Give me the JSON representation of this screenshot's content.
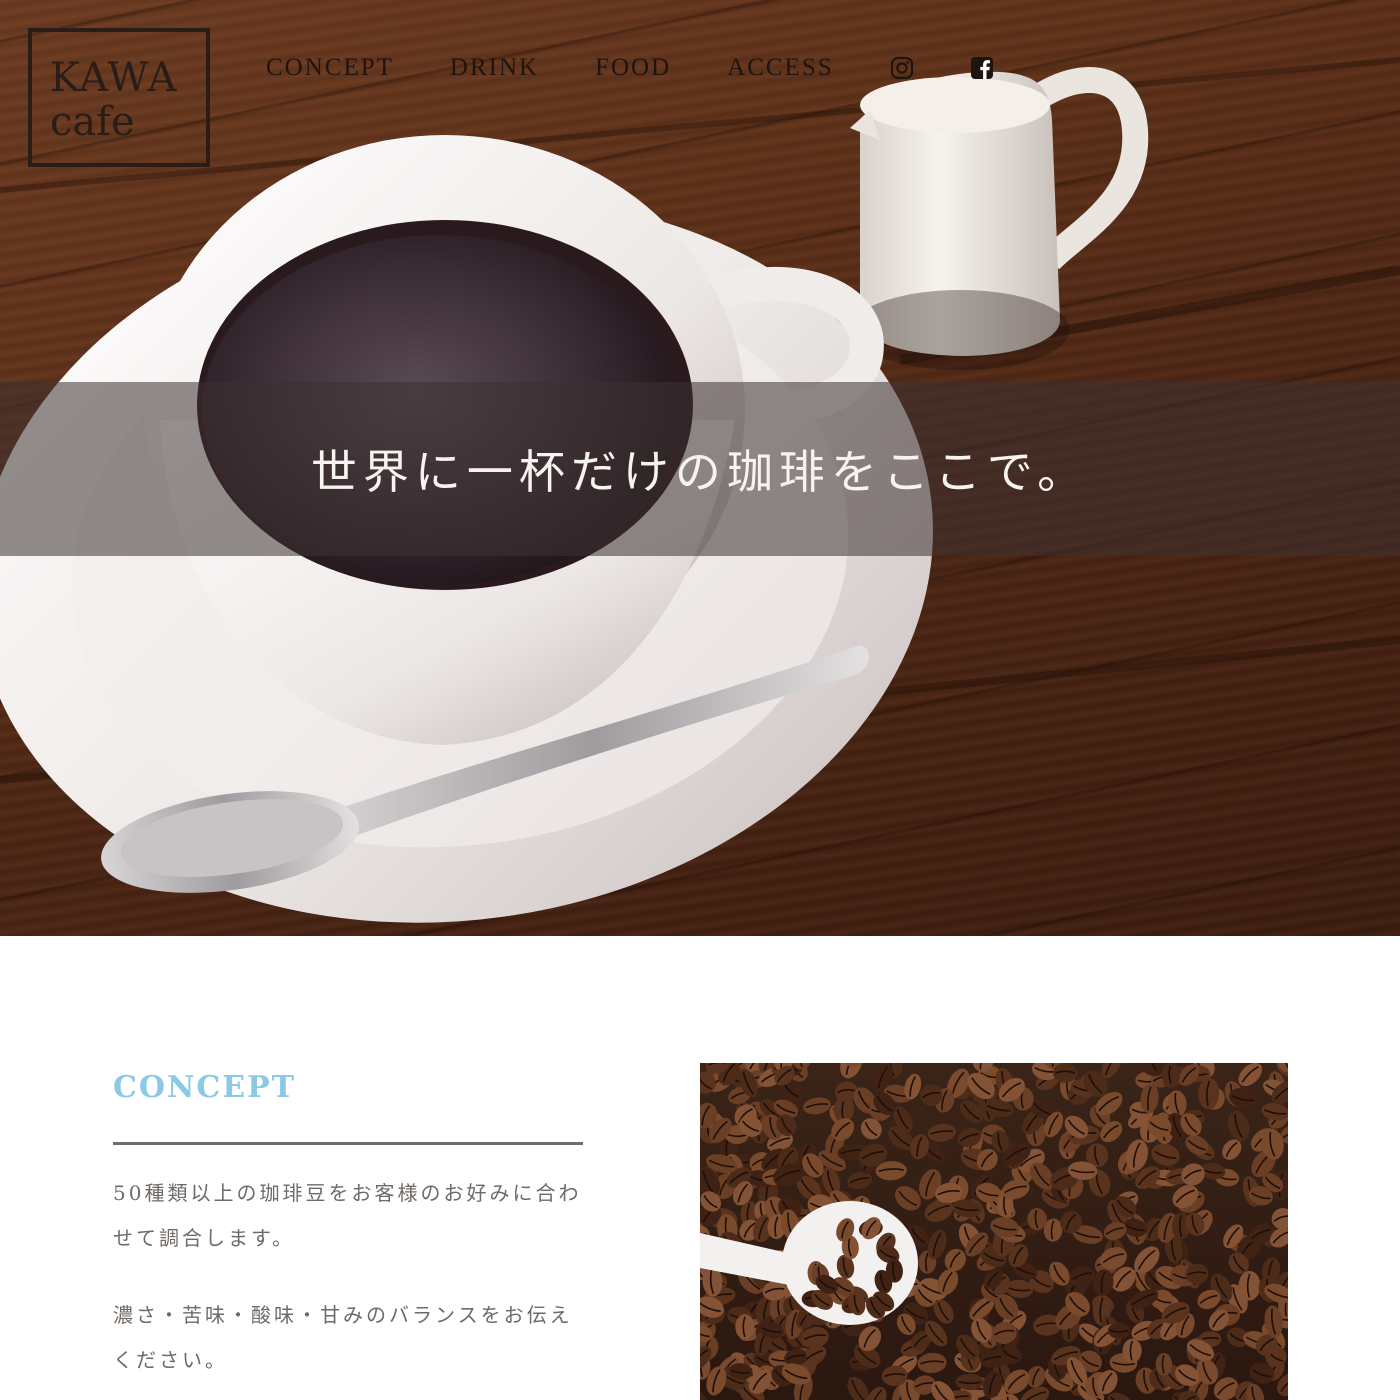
{
  "logo": {
    "line1": "KAWA",
    "line2": "cafe"
  },
  "nav": {
    "items": [
      "CONCEPT",
      "DRINK",
      "FOOD",
      "ACCESS"
    ],
    "social": [
      {
        "icon": "instagram-icon"
      },
      {
        "icon": "facebook-icon"
      }
    ]
  },
  "hero": {
    "headline": "世界に一杯だけの珈琲をここで。"
  },
  "concept": {
    "title": "CONCEPT",
    "paragraphs": [
      "50種類以上の珈琲豆をお客様のお好みに合わせて調合します。",
      "濃さ・苦味・酸味・甘みのバランスをお伝えください。"
    ]
  },
  "colors": {
    "accent": "#8cc9e5",
    "text_dark": "#1f1410",
    "body_text": "#6f6a66",
    "rule": "#6e6e6e"
  }
}
